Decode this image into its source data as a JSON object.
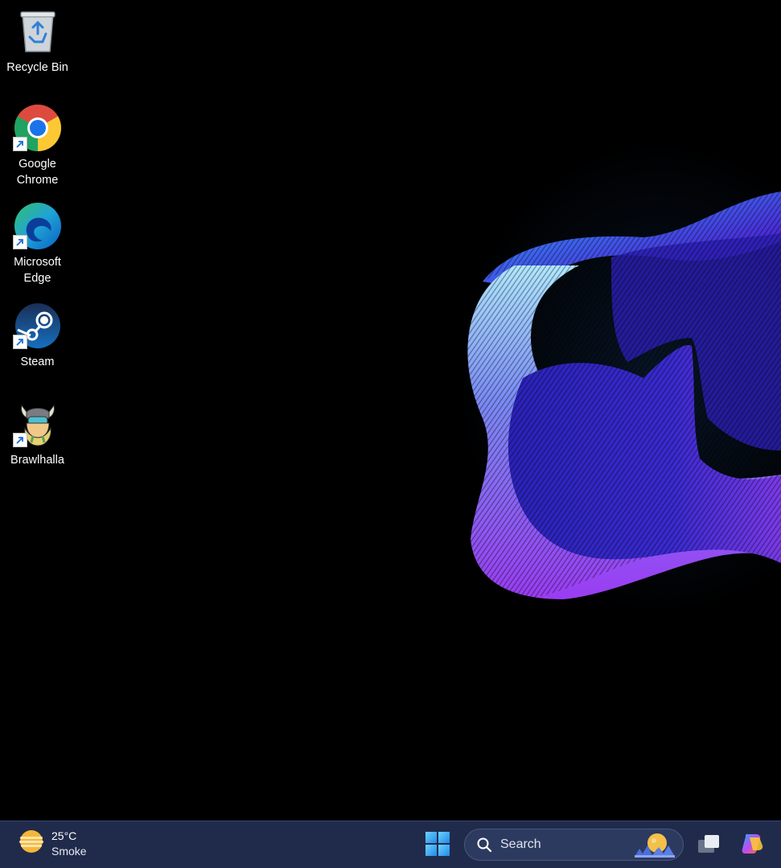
{
  "desktop": {
    "icons": [
      {
        "label": "Recycle Bin",
        "icon": "recycle-bin-icon"
      },
      {
        "label": "Google\nChrome",
        "icon": "chrome-icon"
      },
      {
        "label": "Microsoft\nEdge",
        "icon": "edge-icon"
      },
      {
        "label": "Steam",
        "icon": "steam-icon"
      },
      {
        "label": "Brawlhalla",
        "icon": "brawlhalla-icon"
      }
    ]
  },
  "taskbar": {
    "weather": {
      "temp": "25°C",
      "condition": "Smoke",
      "icon": "weather-smoke-icon"
    },
    "start_icon": "windows-start-icon",
    "search": {
      "placeholder": "Search"
    },
    "task_view_icon": "task-view-icon",
    "copilot_icon": "copilot-icon"
  },
  "colors": {
    "taskbar_bg": "#202b4c",
    "accent": "#2b9cf0"
  }
}
